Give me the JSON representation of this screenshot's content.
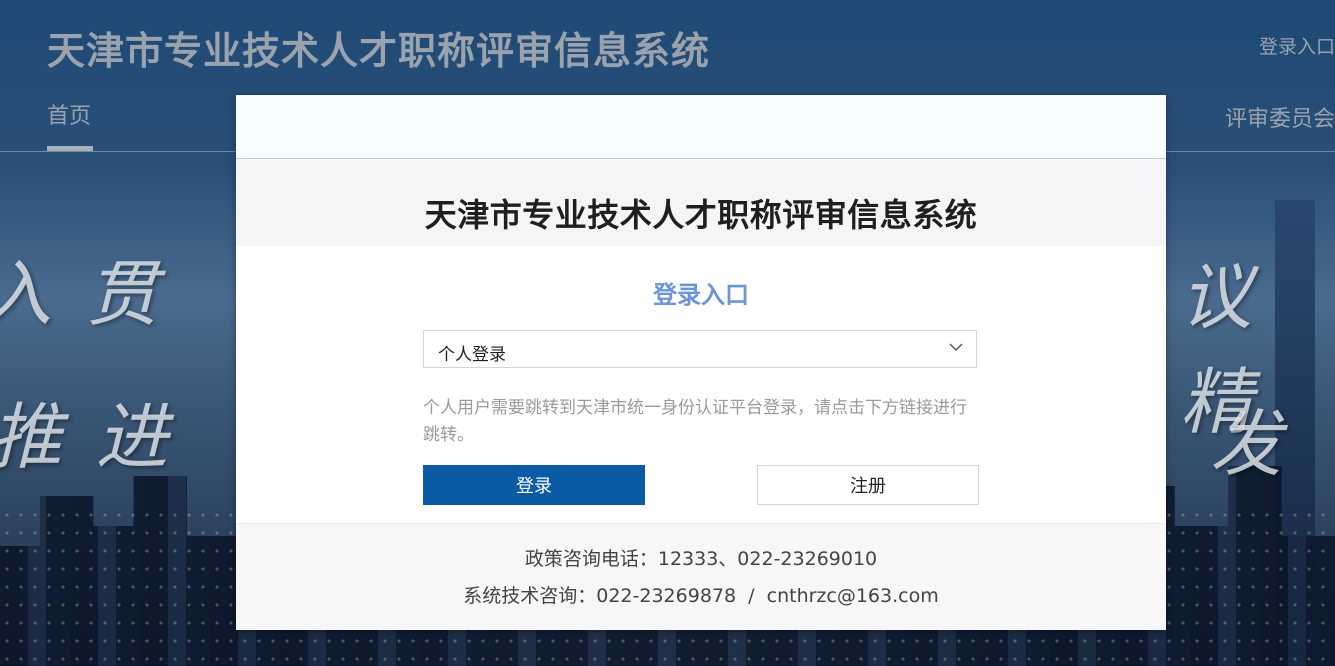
{
  "header": {
    "site_title": "天津市专业技术人才职称评审信息系统",
    "login_link": "登录入口",
    "nav_home": "首页",
    "nav_committee": "评审委员会"
  },
  "background": {
    "left_text_1": "入贯",
    "left_text_2": "推进",
    "right_text_1": "议精",
    "right_text_2": "发"
  },
  "modal": {
    "title": "天津市专业技术人才职称评审信息系统",
    "login_heading": "登录入口",
    "login_type_selected": "个人登录",
    "hint": "个人用户需要跳转到天津市统一身份认证平台登录，请点击下方链接进行跳转。",
    "login_button": "登录",
    "register_button": "注册",
    "footer_policy": "政策咨询电话：12333、022-23269010",
    "footer_tech": "系统技术咨询：022-23269878  /  cnthrzc@163.com"
  },
  "colors": {
    "primary_button": "#0a5ba4",
    "heading_accent": "#6a95d6"
  }
}
